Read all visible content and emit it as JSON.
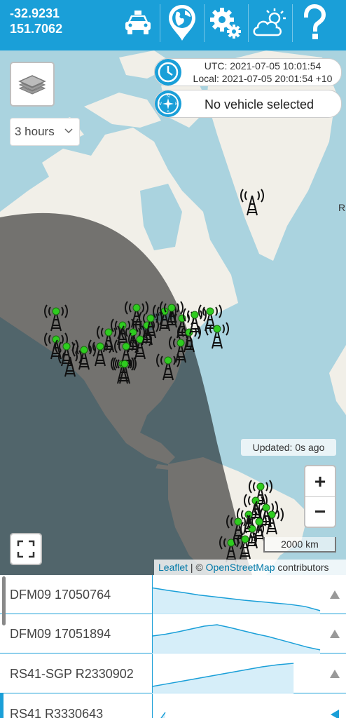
{
  "header": {
    "latitude": "-32.9231",
    "longitude": "151.7062",
    "buttons": [
      {
        "name": "vehicle",
        "icon": "car-icon"
      },
      {
        "name": "map-location",
        "icon": "globe-pin-icon"
      },
      {
        "name": "settings",
        "icon": "gears-icon"
      },
      {
        "name": "weather",
        "icon": "weather-cloud-sun-icon"
      },
      {
        "name": "help",
        "icon": "question-mark-icon"
      }
    ],
    "color": "#1a9fd8"
  },
  "map": {
    "layers_icon": "layers-icon",
    "time_range": {
      "selected": "3 hours"
    },
    "time": {
      "utc": "UTC: 2021-07-05 10:01:54",
      "local": "Local: 2021-07-05 20:01:54 +10",
      "icon": "clock-icon"
    },
    "vehicle": {
      "status": "No vehicle selected",
      "icon": "compass-icon"
    },
    "updated": "Updated: 0s ago",
    "zoom_in": "+",
    "zoom_out": "−",
    "scale": "2000 km",
    "fullscreen_icon": "fullscreen-icon",
    "partial_label": "R",
    "attribution": {
      "leaflet": "Leaflet",
      "separator": " | © ",
      "osm": "OpenStreetMap",
      "suffix": " contributors"
    },
    "marker_icon": "radio-tower-icon",
    "marker_color": "#2ecc1f"
  },
  "sondes": [
    {
      "label": "DFM09 17050764",
      "trend": [
        0.75,
        0.68,
        0.62,
        0.55,
        0.5,
        0.45,
        0.4,
        0.36,
        0.32,
        0.28,
        0.22,
        0.1
      ],
      "marker": "up"
    },
    {
      "label": "DFM09 17051894",
      "trend": [
        0.5,
        0.55,
        0.62,
        0.7,
        0.78,
        0.82,
        0.74,
        0.65,
        0.56,
        0.48,
        0.38,
        0.28,
        0.18,
        0.1
      ],
      "marker": "up"
    },
    {
      "label": "RS41-SGP R2330902",
      "trend": [
        0.2,
        0.28,
        0.36,
        0.44,
        0.52,
        0.6,
        0.68,
        0.76,
        0.82,
        0.86
      ],
      "marker": "up"
    },
    {
      "label": "RS41 R3330643",
      "trend": [
        0.1,
        0.6
      ],
      "marker": "left"
    }
  ]
}
